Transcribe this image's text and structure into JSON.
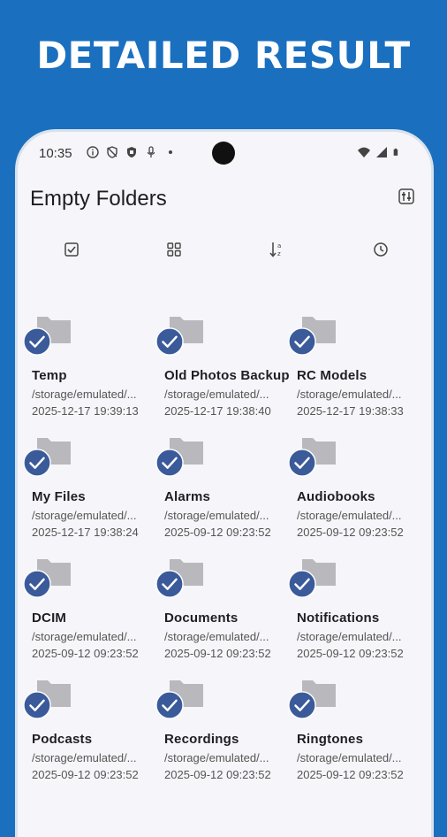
{
  "banner": {
    "title": "DETAILED RESULT"
  },
  "status_bar": {
    "time": "10:35",
    "left_icons": [
      "info-icon",
      "shield-off-icon",
      "shield-icon",
      "mic-icon",
      "dot-icon"
    ],
    "right_icons": [
      "wifi-icon",
      "signal-icon",
      "battery-icon"
    ]
  },
  "appbar": {
    "title": "Empty Folders",
    "action_icon": "filter-settings-icon"
  },
  "toolbar": {
    "icons": [
      "select-all-icon",
      "grid-view-icon",
      "sort-icon",
      "history-icon"
    ]
  },
  "colors": {
    "background": "#1a6fbf",
    "screen": "#f6f6fa",
    "folder": "#b9b9bd",
    "check": "#3b5a9a"
  },
  "folders": [
    {
      "name": "Temp",
      "path": "/storage/emulated/...",
      "date": "2025-12-17 19:39:13",
      "checked": true
    },
    {
      "name": "Old Photos Backup",
      "path": "/storage/emulated/...",
      "date": "2025-12-17 19:38:40",
      "checked": true
    },
    {
      "name": "RC Models",
      "path": "/storage/emulated/...",
      "date": "2025-12-17 19:38:33",
      "checked": true
    },
    {
      "name": "My Files",
      "path": "/storage/emulated/...",
      "date": "2025-12-17 19:38:24",
      "checked": true
    },
    {
      "name": "Alarms",
      "path": "/storage/emulated/...",
      "date": "2025-09-12 09:23:52",
      "checked": true
    },
    {
      "name": "Audiobooks",
      "path": "/storage/emulated/...",
      "date": "2025-09-12 09:23:52",
      "checked": true
    },
    {
      "name": "DCIM",
      "path": "/storage/emulated/...",
      "date": "2025-09-12 09:23:52",
      "checked": true
    },
    {
      "name": "Documents",
      "path": "/storage/emulated/...",
      "date": "2025-09-12 09:23:52",
      "checked": true
    },
    {
      "name": "Notifications",
      "path": "/storage/emulated/...",
      "date": "2025-09-12 09:23:52",
      "checked": true
    },
    {
      "name": "Podcasts",
      "path": "/storage/emulated/...",
      "date": "2025-09-12 09:23:52",
      "checked": true
    },
    {
      "name": "Recordings",
      "path": "/storage/emulated/...",
      "date": "2025-09-12 09:23:52",
      "checked": true
    },
    {
      "name": "Ringtones",
      "path": "/storage/emulated/...",
      "date": "2025-09-12 09:23:52",
      "checked": true
    }
  ]
}
